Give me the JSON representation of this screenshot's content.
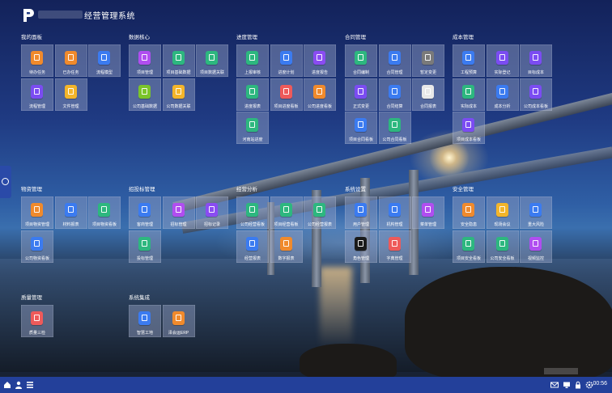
{
  "app": {
    "title": "经营管理系统"
  },
  "sections": [
    {
      "title": "我的面板",
      "tiles": [
        {
          "label": "待办任务",
          "icon": "task-icon",
          "color": "#f08a2c"
        },
        {
          "label": "已办任务",
          "icon": "done-icon",
          "color": "#f08a2c"
        },
        {
          "label": "流程模型",
          "icon": "model-icon",
          "color": "#3b7bf0"
        },
        {
          "label": "流程管理",
          "icon": "flow-icon",
          "color": "#7b4cf2"
        },
        {
          "label": "文件管理",
          "icon": "file-icon",
          "color": "#f3b52a"
        }
      ]
    },
    {
      "title": "数据核心",
      "tiles": [
        {
          "label": "项目管理",
          "icon": "project-icon",
          "color": "#b04ef0"
        },
        {
          "label": "项目基础数据",
          "icon": "db-icon",
          "color": "#2db77f"
        },
        {
          "label": "项目数据关联",
          "icon": "pie-icon",
          "color": "#2db77f"
        },
        {
          "label": "公司基础数据",
          "icon": "db-icon",
          "color": "#7bc42b"
        },
        {
          "label": "公司数据关联",
          "icon": "link-icon",
          "color": "#f3b52a"
        }
      ]
    },
    {
      "title": "进度管理",
      "tiles": [
        {
          "label": "上报审核",
          "icon": "report-icon",
          "color": "#2db77f"
        },
        {
          "label": "进度计划",
          "icon": "plan-icon",
          "color": "#3b7bf0"
        },
        {
          "label": "进度报告",
          "icon": "doc-icon",
          "color": "#8a4cf2"
        },
        {
          "label": "进度报表",
          "icon": "table-icon",
          "color": "#2db77f"
        },
        {
          "label": "项目进度看板",
          "icon": "board-icon",
          "color": "#ee5a5a"
        },
        {
          "label": "公司进度看板",
          "icon": "board-icon",
          "color": "#f08a2c"
        },
        {
          "label": "河南站进度",
          "icon": "station-icon",
          "color": "#2db77f"
        }
      ]
    },
    {
      "title": "合同管理",
      "tiles": [
        {
          "label": "合同编制",
          "icon": "edit-icon",
          "color": "#2db77f"
        },
        {
          "label": "合同管理",
          "icon": "contract-icon",
          "color": "#3b7bf0"
        },
        {
          "label": "暂定变更",
          "icon": "change-icon",
          "color": "#7a7a7a"
        },
        {
          "label": "正式变更",
          "icon": "change-icon",
          "color": "#7b4cf2"
        },
        {
          "label": "合同结算",
          "icon": "settle-icon",
          "color": "#3b7bf0"
        },
        {
          "label": "合同报表",
          "icon": "table-icon",
          "color": "#e8e8e8"
        },
        {
          "label": "项目合同看板",
          "icon": "board-icon",
          "color": "#3b7bf0"
        },
        {
          "label": "公司合同看板",
          "icon": "board-icon",
          "color": "#2db77f"
        }
      ]
    },
    {
      "title": "成本管理",
      "tiles": [
        {
          "label": "工程预算",
          "icon": "budget-icon",
          "color": "#3b7bf0"
        },
        {
          "label": "实际登记",
          "icon": "record-icon",
          "color": "#7b4cf2"
        },
        {
          "label": "目标成本",
          "icon": "target-icon",
          "color": "#7b4cf2"
        },
        {
          "label": "实际成本",
          "icon": "cost-icon",
          "color": "#2db77f"
        },
        {
          "label": "成本分析",
          "icon": "analysis-icon",
          "color": "#3b7bf0"
        },
        {
          "label": "公司成本看板",
          "icon": "board-icon",
          "color": "#7b4cf2"
        },
        {
          "label": "项目成本看板",
          "icon": "board-icon",
          "color": "#7b4cf2"
        }
      ]
    },
    {
      "title": "物资管理",
      "tiles": [
        {
          "label": "项目物资管理",
          "icon": "material-icon",
          "color": "#f08a2c"
        },
        {
          "label": "材料报表",
          "icon": "table-icon",
          "color": "#3b7bf0"
        },
        {
          "label": "项目物资看板",
          "icon": "board-icon",
          "color": "#2db77f"
        },
        {
          "label": "公司物资看板",
          "icon": "board-icon",
          "color": "#3b7bf0"
        }
      ]
    },
    {
      "title": "招投标管理",
      "tiles": [
        {
          "label": "客商管理",
          "icon": "merchant-icon",
          "color": "#3b7bf0"
        },
        {
          "label": "招标管理",
          "icon": "bid-icon",
          "color": "#b04ef0"
        },
        {
          "label": "招标记录",
          "icon": "record-icon",
          "color": "#8a4cf2"
        },
        {
          "label": "投标管理",
          "icon": "tender-icon",
          "color": "#2db77f"
        }
      ]
    },
    {
      "title": "经营分析",
      "tiles": [
        {
          "label": "公司经营看板",
          "icon": "board-icon",
          "color": "#2db77f"
        },
        {
          "label": "项目经营看板",
          "icon": "board-icon",
          "color": "#2db77f"
        },
        {
          "label": "公司经营报表",
          "icon": "table-icon",
          "color": "#2db77f"
        },
        {
          "label": "经营报表",
          "icon": "table-icon",
          "color": "#3b7bf0"
        },
        {
          "label": "数字报表",
          "icon": "chart-icon",
          "color": "#f08a2c"
        }
      ]
    },
    {
      "title": "系统设置",
      "tiles": [
        {
          "label": "用户管理",
          "icon": "user-icon",
          "color": "#3b7bf0"
        },
        {
          "label": "机构管理",
          "icon": "org-icon",
          "color": "#3b7bf0"
        },
        {
          "label": "菜单管理",
          "icon": "menu-icon",
          "color": "#b04ef0"
        },
        {
          "label": "角色管理",
          "icon": "role-icon",
          "color": "#1a1a1a"
        },
        {
          "label": "字典管理",
          "icon": "dict-icon",
          "color": "#ee5a5a"
        }
      ]
    },
    {
      "title": "安全管理",
      "tiles": [
        {
          "label": "安全隐患",
          "icon": "hazard-icon",
          "color": "#f08a2c"
        },
        {
          "label": "现场会议",
          "icon": "meeting-icon",
          "color": "#f3b52a"
        },
        {
          "label": "重大风险",
          "icon": "risk-icon",
          "color": "#3b7bf0"
        },
        {
          "label": "项目安全看板",
          "icon": "board-icon",
          "color": "#2db77f"
        },
        {
          "label": "公司安全看板",
          "icon": "board-icon",
          "color": "#2db77f"
        },
        {
          "label": "视频监控",
          "icon": "video-icon",
          "color": "#b04ef0"
        }
      ]
    },
    {
      "title": "质量管理",
      "tiles": [
        {
          "label": "质量三检",
          "icon": "quality-icon",
          "color": "#ee5a5a"
        }
      ]
    },
    {
      "title": "系统集成",
      "tiles": [
        {
          "label": "智慧工地",
          "icon": "site-icon",
          "color": "#3b7bf0"
        },
        {
          "label": "泽会运ERP",
          "icon": "erp-icon",
          "color": "#f08a2c"
        }
      ]
    }
  ],
  "taskbar": {
    "left_icons": [
      "home-icon",
      "user-icon",
      "menu-icon"
    ],
    "right_icons": [
      "mail-icon",
      "screen-icon",
      "lock-icon",
      "settings-icon"
    ],
    "time": "00:56"
  }
}
